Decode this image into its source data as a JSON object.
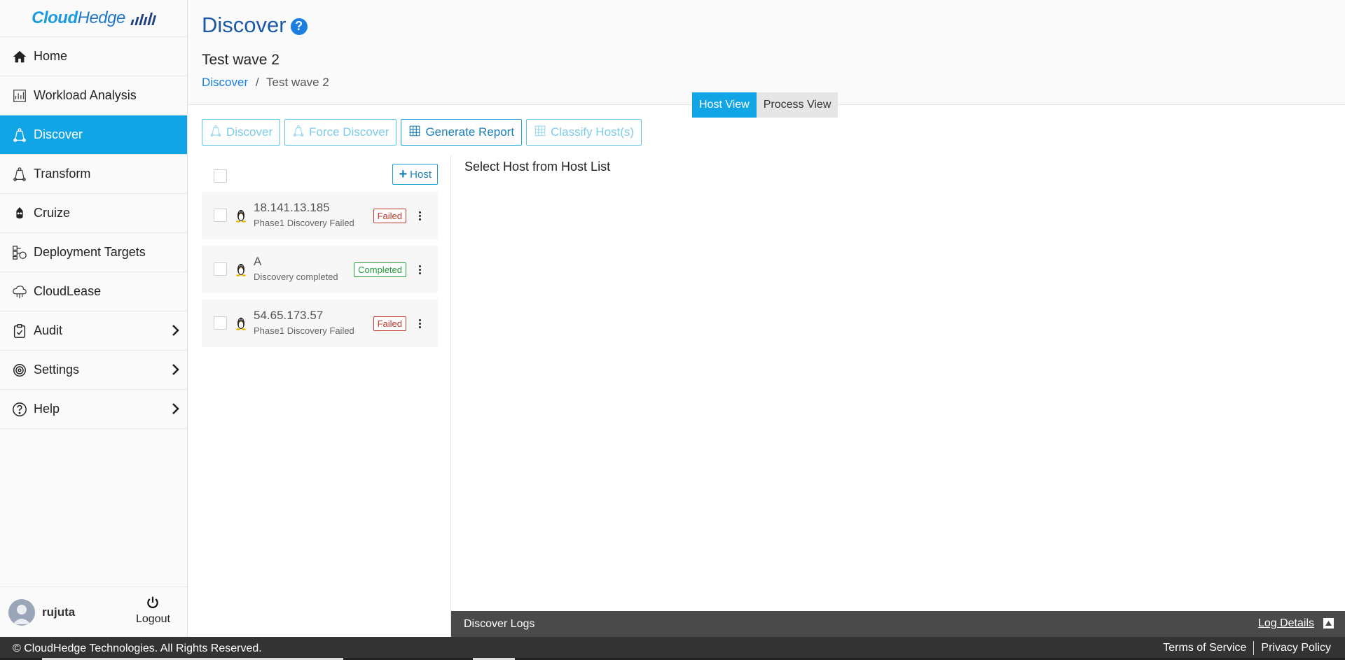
{
  "sidebar": {
    "logo": {
      "text_a": "Cloud",
      "text_b": "Hedge"
    },
    "items": [
      {
        "label": "Home",
        "icon": "home-icon"
      },
      {
        "label": "Workload Analysis",
        "icon": "analysis-icon"
      },
      {
        "label": "Discover",
        "icon": "discover-icon",
        "active": true
      },
      {
        "label": "Transform",
        "icon": "transform-icon"
      },
      {
        "label": "Cruize",
        "icon": "robot-icon"
      },
      {
        "label": "Deployment Targets",
        "icon": "deployment-icon"
      },
      {
        "label": "CloudLease",
        "icon": "cloud-icon"
      },
      {
        "label": "Audit",
        "icon": "clipboard-icon",
        "expandable": true
      },
      {
        "label": "Settings",
        "icon": "gear-icon",
        "expandable": true
      },
      {
        "label": "Help",
        "icon": "question-icon",
        "expandable": true
      }
    ],
    "user": {
      "name": "rujuta",
      "logout_label": "Logout"
    }
  },
  "header": {
    "title": "Discover",
    "wave_title": "Test wave 2",
    "breadcrumb": {
      "link": "Discover",
      "separator": "/",
      "current": "Test wave 2"
    },
    "view_toggle": {
      "host_view": "Host View",
      "process_view": "Process View"
    }
  },
  "toolbar": {
    "discover": "Discover",
    "force_discover": "Force Discover",
    "generate_report": "Generate Report",
    "classify_hosts": "Classify Host(s)"
  },
  "host_list": {
    "add_host_label": "Host",
    "hosts": [
      {
        "name": "18.141.13.185",
        "status_text": "Phase1 Discovery Failed",
        "badge": "Failed",
        "badge_type": "failed"
      },
      {
        "name": "A",
        "status_text": "Discovery completed",
        "badge": "Completed",
        "badge_type": "completed"
      },
      {
        "name": "54.65.173.57",
        "status_text": "Phase1 Discovery Failed",
        "badge": "Failed",
        "badge_type": "failed"
      }
    ]
  },
  "detail": {
    "empty_text": "Select Host from Host List"
  },
  "logs": {
    "title": "Discover Logs",
    "details_link": "Log Details"
  },
  "footer": {
    "copyright": "© CloudHedge Technologies. All Rights Reserved.",
    "terms": "Terms of Service",
    "privacy": "Privacy Policy"
  },
  "colors": {
    "accent": "#12a5e6",
    "title_blue": "#1d5aa6",
    "failed": "#c0392b",
    "completed": "#1f9a3a",
    "footer": "#333333"
  }
}
